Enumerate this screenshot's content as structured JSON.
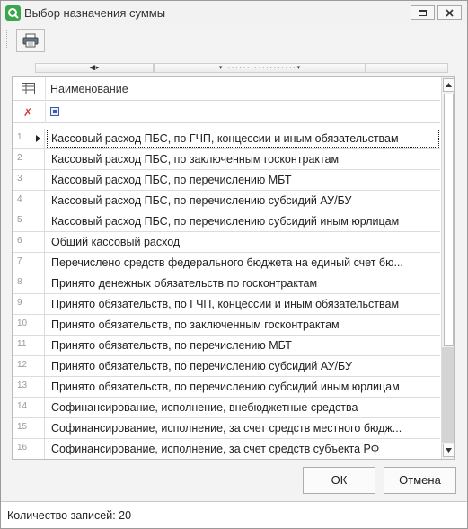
{
  "window": {
    "title": "Выбор назначения суммы",
    "accent_color": "#3aa64b"
  },
  "toolbar": {
    "print_icon": "printer-icon"
  },
  "grid": {
    "column_header": "Наименование",
    "rows": [
      {
        "num": "1",
        "name": "Кассовый расход ПБС, по ГЧП, концессии и иным обязательствам"
      },
      {
        "num": "2",
        "name": "Кассовый расход ПБС, по заключенным госконтрактам"
      },
      {
        "num": "3",
        "name": "Кассовый расход ПБС, по перечислению МБТ"
      },
      {
        "num": "4",
        "name": "Кассовый расход ПБС, по перечислению субсидий АУ/БУ"
      },
      {
        "num": "5",
        "name": "Кассовый расход ПБС, по перечислению субсидий иным юрлицам"
      },
      {
        "num": "6",
        "name": "Общий кассовый расход"
      },
      {
        "num": "7",
        "name": "Перечислено средств федерального бюджета на единый счет бю..."
      },
      {
        "num": "8",
        "name": "Принято денежных обязательств по госконтрактам"
      },
      {
        "num": "9",
        "name": "Принято обязательств, по ГЧП, концессии и иным обязательствам"
      },
      {
        "num": "10",
        "name": "Принято обязательств, по заключенным госконтрактам"
      },
      {
        "num": "11",
        "name": "Принято обязательств, по перечислению МБТ"
      },
      {
        "num": "12",
        "name": "Принято обязательств, по перечислению субсидий АУ/БУ"
      },
      {
        "num": "13",
        "name": "Принято обязательств, по перечислению субсидий иным юрлицам"
      },
      {
        "num": "14",
        "name": "Софинансирование, исполнение, внебюджетные средства"
      },
      {
        "num": "15",
        "name": "Софинансирование, исполнение, за счет средств местного бюдж..."
      },
      {
        "num": "16",
        "name": "Софинансирование, исполнение, за счет средств субъекта РФ"
      }
    ]
  },
  "buttons": {
    "ok": "ОК",
    "cancel": "Отмена"
  },
  "status": {
    "text": "Количество записей: 20"
  }
}
